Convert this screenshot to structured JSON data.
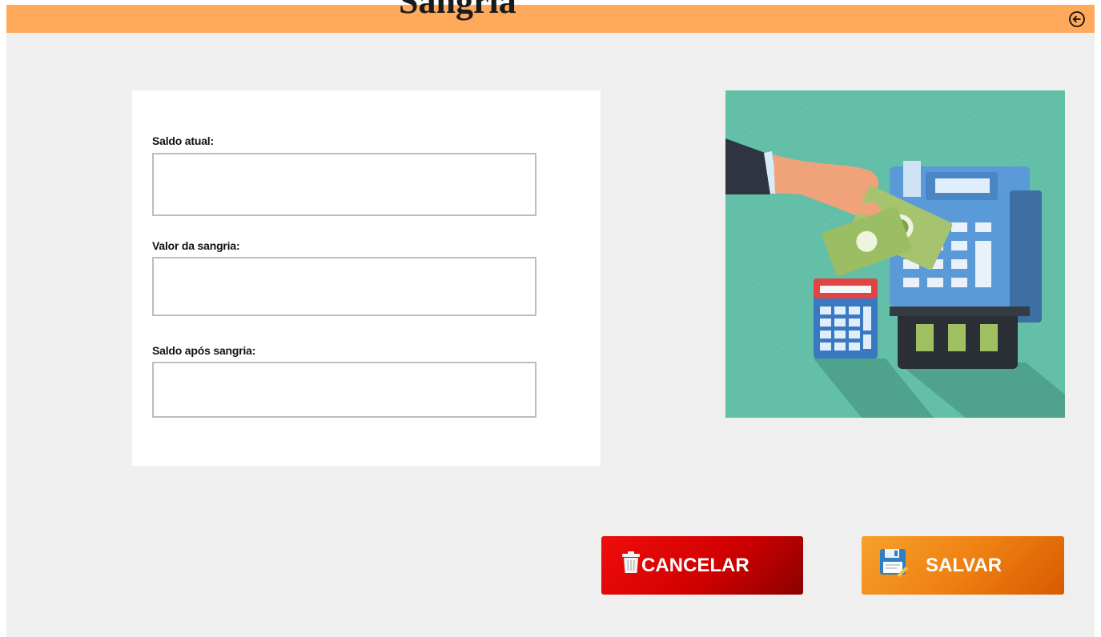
{
  "header": {
    "title": "Sangria",
    "back_icon": "arrow-left-circle-icon",
    "color": "#ffa95a"
  },
  "form": {
    "fields": [
      {
        "label": "Saldo atual:",
        "value": "",
        "placeholder": ""
      },
      {
        "label": "Valor da sangria:",
        "value": "",
        "placeholder": ""
      },
      {
        "label": "Saldo após sangria:",
        "value": "",
        "placeholder": ""
      }
    ]
  },
  "illustration": {
    "description_icon": "cash-register-payment-illustration",
    "background": "#63bfa7"
  },
  "actions": {
    "cancel_label": "CANCELAR",
    "cancel_icon": "trash-icon",
    "cancel_color": "#e00000",
    "save_label": "SALVAR",
    "save_icon": "floppy-disk-icon",
    "save_color": "#f28a1a"
  }
}
